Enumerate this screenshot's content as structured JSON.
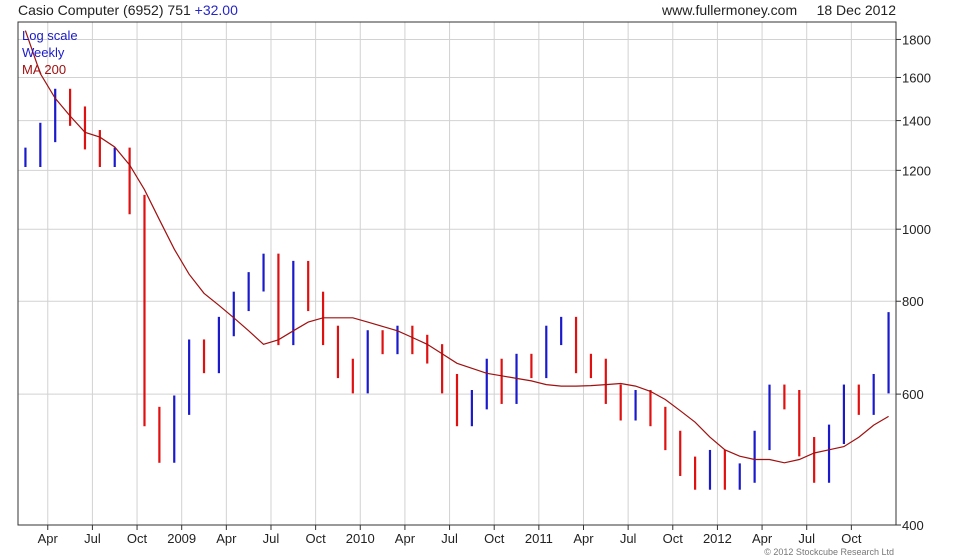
{
  "header": {
    "company": "Casio Computer (6952)",
    "price": "751",
    "change": "+32.00",
    "site": "www.fullermoney.com",
    "date": "18 Dec 2012"
  },
  "footer": {
    "copyright": "© 2012 Stockcube Research Ltd"
  },
  "colors": {
    "up": "#1a1acc",
    "down": "#e01010",
    "ma": "#a01010",
    "grid": "#d2d2d2",
    "frame": "#333333"
  },
  "chart_data": {
    "type": "line",
    "scale": "log",
    "legend": [
      "Log scale",
      "Weekly",
      "MA 200"
    ],
    "legend_position": "top-left",
    "grid": true,
    "ylim": [
      400,
      1900
    ],
    "y_ticks": [
      400,
      600,
      800,
      1000,
      1200,
      1400,
      1600,
      1800
    ],
    "xlim": [
      "2008-02",
      "2012-12"
    ],
    "x_ticks": [
      {
        "label": "Apr",
        "x": "2008-04"
      },
      {
        "label": "Jul",
        "x": "2008-07"
      },
      {
        "label": "Oct",
        "x": "2008-10"
      },
      {
        "label": "2009",
        "x": "2009-01"
      },
      {
        "label": "Apr",
        "x": "2009-04"
      },
      {
        "label": "Jul",
        "x": "2009-07"
      },
      {
        "label": "Oct",
        "x": "2009-10"
      },
      {
        "label": "2010",
        "x": "2010-01"
      },
      {
        "label": "Apr",
        "x": "2010-04"
      },
      {
        "label": "Jul",
        "x": "2010-07"
      },
      {
        "label": "Oct",
        "x": "2010-10"
      },
      {
        "label": "2011",
        "x": "2011-01"
      },
      {
        "label": "Apr",
        "x": "2011-04"
      },
      {
        "label": "Jul",
        "x": "2011-07"
      },
      {
        "label": "Oct",
        "x": "2011-10"
      },
      {
        "label": "2012",
        "x": "2012-01"
      },
      {
        "label": "Apr",
        "x": "2012-04"
      },
      {
        "label": "Jul",
        "x": "2012-07"
      },
      {
        "label": "Oct",
        "x": "2012-10"
      }
    ],
    "series": [
      {
        "name": "Weekly",
        "style": "ohlc-bars",
        "x": [
          "2008-02",
          "2008-03",
          "2008-04",
          "2008-05",
          "2008-06",
          "2008-07",
          "2008-08",
          "2008-09",
          "2008-10",
          "2008-11",
          "2008-12",
          "2009-01",
          "2009-02",
          "2009-03",
          "2009-04",
          "2009-05",
          "2009-06",
          "2009-07",
          "2009-08",
          "2009-09",
          "2009-10",
          "2009-11",
          "2009-12",
          "2010-01",
          "2010-02",
          "2010-03",
          "2010-04",
          "2010-05",
          "2010-06",
          "2010-07",
          "2010-08",
          "2010-09",
          "2010-10",
          "2010-11",
          "2010-12",
          "2011-01",
          "2011-02",
          "2011-03",
          "2011-04",
          "2011-05",
          "2011-06",
          "2011-07",
          "2011-08",
          "2011-09",
          "2011-10",
          "2011-11",
          "2011-12",
          "2012-01",
          "2012-02",
          "2012-03",
          "2012-04",
          "2012-05",
          "2012-06",
          "2012-07",
          "2012-08",
          "2012-09",
          "2012-10",
          "2012-11",
          "2012-12"
        ],
        "values": [
          1250,
          1350,
          1500,
          1420,
          1320,
          1250,
          1250,
          1080,
          560,
          500,
          580,
          690,
          660,
          740,
          800,
          850,
          900,
          720,
          880,
          800,
          720,
          650,
          620,
          710,
          700,
          720,
          700,
          680,
          620,
          560,
          590,
          650,
          600,
          660,
          650,
          720,
          740,
          660,
          650,
          600,
          570,
          590,
          560,
          520,
          480,
          460,
          490,
          460,
          470,
          520,
          600,
          590,
          510,
          470,
          530,
          600,
          580,
          620,
          751
        ]
      },
      {
        "name": "MA 200",
        "style": "line",
        "x": [
          "2008-02",
          "2008-03",
          "2008-04",
          "2008-05",
          "2008-06",
          "2008-07",
          "2008-08",
          "2008-09",
          "2008-10",
          "2008-11",
          "2008-12",
          "2009-01",
          "2009-02",
          "2009-03",
          "2009-04",
          "2009-05",
          "2009-06",
          "2009-07",
          "2009-08",
          "2009-09",
          "2009-10",
          "2009-11",
          "2009-12",
          "2010-01",
          "2010-02",
          "2010-03",
          "2010-04",
          "2010-05",
          "2010-06",
          "2010-07",
          "2010-08",
          "2010-09",
          "2010-10",
          "2010-11",
          "2010-12",
          "2011-01",
          "2011-02",
          "2011-03",
          "2011-04",
          "2011-05",
          "2011-06",
          "2011-07",
          "2011-08",
          "2011-09",
          "2011-10",
          "2011-11",
          "2011-12",
          "2012-01",
          "2012-02",
          "2012-03",
          "2012-04",
          "2012-05",
          "2012-06",
          "2012-07",
          "2012-08",
          "2012-09",
          "2012-10",
          "2012-11",
          "2012-12"
        ],
        "values": [
          1850,
          1620,
          1500,
          1420,
          1350,
          1330,
          1290,
          1220,
          1130,
          1030,
          940,
          870,
          820,
          790,
          760,
          730,
          700,
          710,
          730,
          750,
          760,
          760,
          760,
          750,
          740,
          730,
          715,
          700,
          680,
          660,
          650,
          640,
          635,
          630,
          625,
          618,
          615,
          615,
          616,
          618,
          620,
          615,
          605,
          590,
          570,
          550,
          525,
          505,
          495,
          490,
          490,
          485,
          490,
          500,
          505,
          510,
          525,
          545,
          560
        ]
      }
    ]
  }
}
